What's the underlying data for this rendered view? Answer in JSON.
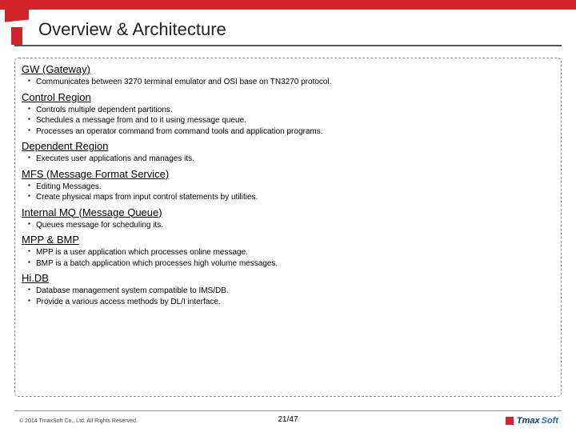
{
  "title": "Overview & Architecture",
  "sections": [
    {
      "heading": "GW (Gateway)",
      "items": [
        "Communicates between 3270 terminal emulator and OSI base on TN3270 protocol."
      ]
    },
    {
      "heading": "Control Region",
      "items": [
        "Controls multiple dependent partitions.",
        "Schedules a message from and to it using message queue.",
        "Processes an operator command from command tools and application programs."
      ]
    },
    {
      "heading": "Dependent Region",
      "items": [
        "Executes user applications and manages its."
      ]
    },
    {
      "heading": "MFS (Message Format Service)",
      "items": [
        "Editing Messages.",
        "Create physical maps from input control statements by utilities."
      ]
    },
    {
      "heading": "Internal MQ (Message Queue)",
      "items": [
        "Queues message for scheduling its."
      ]
    },
    {
      "heading": "MPP & BMP",
      "items": [
        "MPP is a user application which processes online message.",
        "BMP is a batch application which processes high volume messages."
      ]
    },
    {
      "heading": "Hi.DB",
      "items": [
        "Database management system compatible to IMS/DB.",
        "Provide a various access methods by DL/I interface."
      ]
    }
  ],
  "footer": {
    "copyright": "© 2014 TmaxSoft Co., Ltd. All Rights Reserved.",
    "pager": "21/47",
    "brand_main": "Tmax",
    "brand_suffix": "Soft"
  }
}
